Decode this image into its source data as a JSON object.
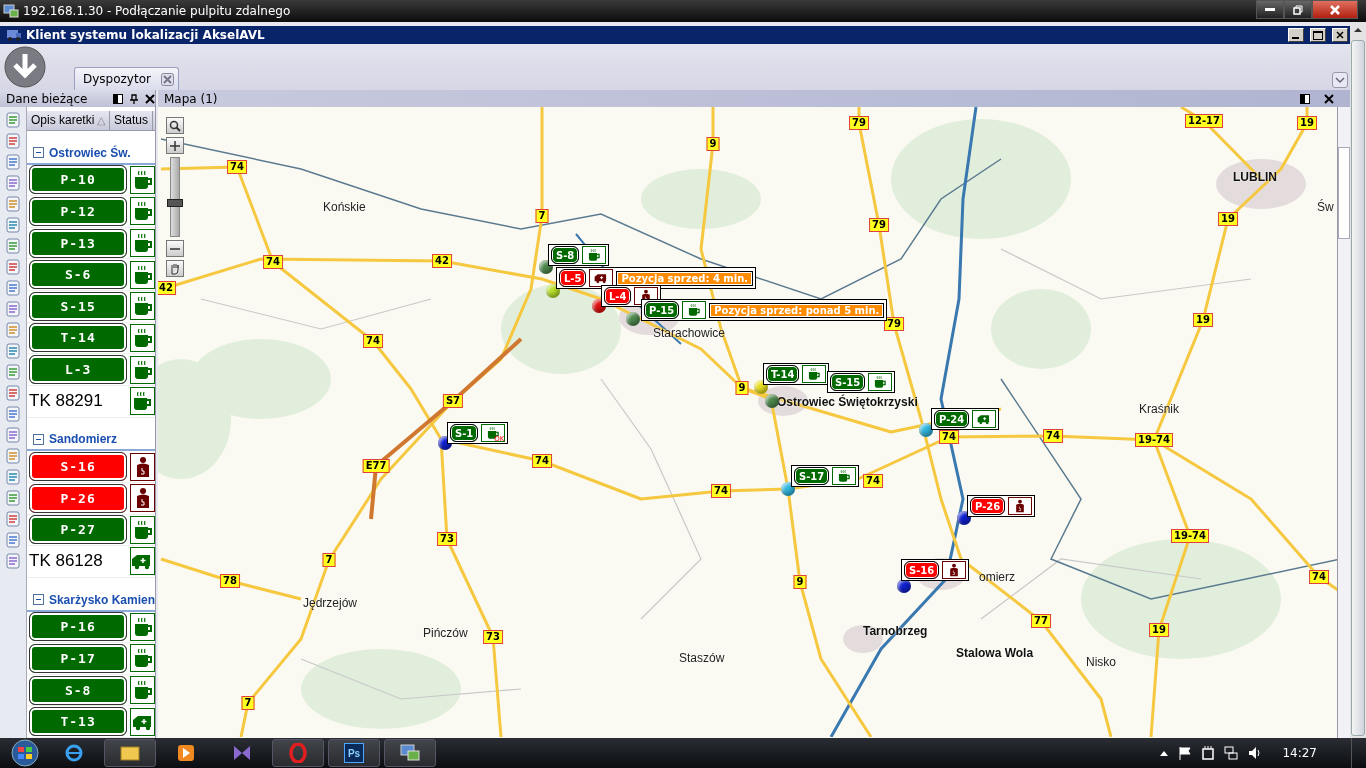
{
  "rdp": {
    "title": "192.168.1.30 - Podłączanie pulpitu zdalnego"
  },
  "app": {
    "title": "Klient systemu lokalizacji AkselAVL"
  },
  "tabs": [
    {
      "label": "Dyspozytor",
      "selected": true
    }
  ],
  "left_panel": {
    "title": "Dane bieżące",
    "columns": [
      "Opis karetki",
      "Status"
    ],
    "sort_mark": "△",
    "groups": [
      {
        "name": "Ostrowiec Św.",
        "expanded": true,
        "units": [
          {
            "label": "P-10",
            "kind": "badge",
            "busy": false,
            "status": {
              "kind": "cup"
            }
          },
          {
            "label": "P-12",
            "kind": "badge",
            "busy": false,
            "status": {
              "kind": "cup"
            }
          },
          {
            "label": "P-13",
            "kind": "badge",
            "busy": false,
            "status": {
              "kind": "cup"
            }
          },
          {
            "label": "S-6",
            "kind": "badge",
            "busy": false,
            "status": {
              "kind": "cup"
            }
          },
          {
            "label": "S-15",
            "kind": "badge",
            "busy": false,
            "status": {
              "kind": "cup"
            }
          },
          {
            "label": "T-14",
            "kind": "badge",
            "busy": false,
            "status": {
              "kind": "cup"
            }
          },
          {
            "label": "L-3",
            "kind": "badge",
            "busy": false,
            "status": {
              "kind": "cup"
            }
          },
          {
            "label": "TK 88291",
            "kind": "plain",
            "busy": false,
            "status": {
              "kind": "cup"
            }
          }
        ]
      },
      {
        "name": "Sandomierz",
        "expanded": true,
        "units": [
          {
            "label": "S-16",
            "kind": "badge",
            "busy": true,
            "status": {
              "kind": "person"
            }
          },
          {
            "label": "P-26",
            "kind": "badge",
            "busy": true,
            "status": {
              "kind": "person"
            }
          },
          {
            "label": "P-27",
            "kind": "badge",
            "busy": false,
            "status": {
              "kind": "cup"
            }
          },
          {
            "label": "TK 86128",
            "kind": "plain",
            "busy": false,
            "status": {
              "kind": "ambulance"
            }
          }
        ]
      },
      {
        "name": "Skarżysko Kamien",
        "expanded": true,
        "units": [
          {
            "label": "P-16",
            "kind": "badge",
            "busy": false,
            "status": {
              "kind": "cup"
            }
          },
          {
            "label": "P-17",
            "kind": "badge",
            "busy": false,
            "status": {
              "kind": "cup"
            }
          },
          {
            "label": "S-8",
            "kind": "badge",
            "busy": false,
            "status": {
              "kind": "cup"
            }
          },
          {
            "label": "T-13",
            "kind": "badge",
            "busy": false,
            "status": {
              "kind": "ambulance"
            }
          }
        ]
      }
    ]
  },
  "map": {
    "title": "Mapa (1)",
    "zoom": {
      "level": 0.4
    },
    "places": [
      {
        "name": "Końskie",
        "kind": "town"
      },
      {
        "name": "Starachowice",
        "kind": "town"
      },
      {
        "name": "Ostrowiec Świętokrzyski",
        "kind": "city"
      },
      {
        "name": "LUBLIN",
        "kind": "city"
      },
      {
        "name": "Św",
        "kind": "town"
      },
      {
        "name": "Kraśnik",
        "kind": "town"
      },
      {
        "name": "Jędrzejów",
        "kind": "town"
      },
      {
        "name": "Staszów",
        "kind": "town"
      },
      {
        "name": "Tarnobrzeg",
        "kind": "city"
      },
      {
        "name": "Stalowa Wola",
        "kind": "city"
      },
      {
        "name": "Nisko",
        "kind": "town"
      },
      {
        "name": "Pińczów",
        "kind": "town"
      },
      {
        "name": "omierz",
        "kind": "town"
      }
    ],
    "road_numbers": [
      "74",
      "42",
      "7",
      "79",
      "9",
      "79",
      "79",
      "74",
      "42",
      "74",
      "9",
      "S7",
      "E77",
      "74",
      "74",
      "74",
      "74",
      "74",
      "12-17",
      "19",
      "19",
      "19",
      "19-74",
      "19-74",
      "74",
      "19",
      "77",
      "9",
      "73",
      "73",
      "7",
      "78",
      "7"
    ],
    "markers": [
      {
        "label": "S-8",
        "busy": false,
        "status": {
          "kind": "cup"
        },
        "color": "#4f8a4f"
      },
      {
        "label": "L-5",
        "busy": true,
        "status": {
          "kind": "ambulance"
        },
        "color": "#b8e02a",
        "note": "Pozycja sprzed: 4 min."
      },
      {
        "label": "L-4",
        "busy": true,
        "status": {
          "kind": "person"
        },
        "color": "#e01010"
      },
      {
        "label": "P-15",
        "busy": false,
        "status": {
          "kind": "cup"
        },
        "color": "#4f8a4f",
        "note": "Pozycja sprzed: ponad 5 min."
      },
      {
        "label": "T-14",
        "busy": false,
        "status": {
          "kind": "cup"
        },
        "color": "#e8e020"
      },
      {
        "label": "S-15",
        "busy": false,
        "status": {
          "kind": "cup"
        },
        "color": "#4f8a4f"
      },
      {
        "label": "S-1",
        "busy": false,
        "status": {
          "kind": "cup",
          "text": "OK"
        },
        "color": "#1020d0"
      },
      {
        "label": "P-24",
        "busy": false,
        "status": {
          "kind": "ambulance"
        },
        "color": "#30b8e0"
      },
      {
        "label": "S-17",
        "busy": false,
        "status": {
          "kind": "cup"
        },
        "color": "#30b8e0"
      },
      {
        "label": "P-26",
        "busy": true,
        "status": {
          "kind": "person"
        },
        "color": "#1020d0"
      },
      {
        "label": "S-16",
        "busy": true,
        "status": {
          "kind": "person"
        },
        "color": "#1020d0"
      }
    ]
  },
  "taskbar": {
    "app_text": "Ps",
    "clock": "14:27"
  }
}
